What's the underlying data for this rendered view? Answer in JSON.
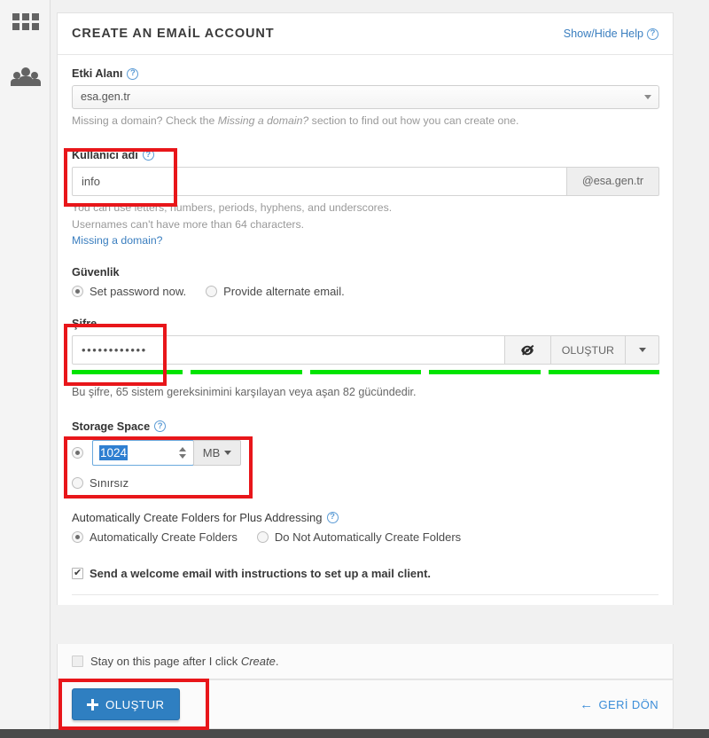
{
  "sidebar": {
    "items": [
      {
        "name": "apps-grid",
        "icon": "grid-icon"
      },
      {
        "name": "users",
        "icon": "people-icon"
      }
    ]
  },
  "header": {
    "title": "CREATE AN EMAİL ACCOUNT",
    "help_toggle": "Show/Hide Help",
    "help_icon": "question-mark-icon"
  },
  "domain": {
    "label": "Etki Alanı",
    "help_icon": "question-mark-icon",
    "selected": "esa.gen.tr",
    "options": [
      "esa.gen.tr"
    ],
    "helptext_before": "Missing a domain? Check the ",
    "helptext_italic": "Missing a domain?",
    "helptext_after": " section to find out how you can create one."
  },
  "username": {
    "label": "Kullanıcı adı",
    "help_icon": "question-mark-icon",
    "value": "info",
    "placeholder": "",
    "suffix": "@esa.gen.tr",
    "hint1": "You can use letters, numbers, periods, hyphens, and underscores.",
    "hint2": "Usernames can't have more than 64 characters.",
    "link": "Missing a domain?"
  },
  "security": {
    "label": "Güvenlik",
    "options": [
      {
        "label": "Set password now.",
        "selected": true
      },
      {
        "label": "Provide alternate email.",
        "selected": false
      }
    ]
  },
  "password": {
    "label": "Şifre",
    "value": "••••••••••••",
    "masked_char_count": 12,
    "toggle_icon": "eye-slash-icon",
    "generate_label": "OLUŞTUR",
    "dropdown_icon": "chevron-down-icon",
    "strength_segments": 5,
    "strength_color": "#00e400",
    "strength_text": "Bu şifre, 65 sistem gereksinimini karşılayan veya aşan 82 gücündedir."
  },
  "storage": {
    "label": "Storage Space",
    "help_icon": "question-mark-icon",
    "value": "1024",
    "value_selected": true,
    "unit": "MB",
    "unit_icon": "chevron-down-icon",
    "stepper_up_icon": "caret-up-icon",
    "stepper_down_icon": "caret-down-icon",
    "radio_quota_selected": true,
    "unlimited_label": "Sınırsız",
    "unlimited_selected": false
  },
  "folders": {
    "label": "Automatically Create Folders for Plus Addressing",
    "help_icon": "question-mark-icon",
    "options": [
      {
        "label": "Automatically Create Folders",
        "selected": true
      },
      {
        "label": "Do Not Automatically Create Folders",
        "selected": false
      }
    ]
  },
  "welcome": {
    "label": "Send a welcome email with instructions to set up a mail client.",
    "checked": true
  },
  "stay": {
    "prefix": "Stay on this page after I click ",
    "italic": "Create",
    "suffix": ".",
    "checked": false
  },
  "actions": {
    "create_label": "OLUŞTUR",
    "create_icon": "plus-icon",
    "create_color": "#2f7fc1",
    "back_label": "GERİ DÖN",
    "back_icon": "arrow-left-icon"
  },
  "annotations": {
    "color": "#e8161a",
    "boxes": [
      {
        "name": "username-highlight"
      },
      {
        "name": "password-highlight"
      },
      {
        "name": "storage-highlight"
      },
      {
        "name": "create-button-highlight"
      }
    ]
  }
}
